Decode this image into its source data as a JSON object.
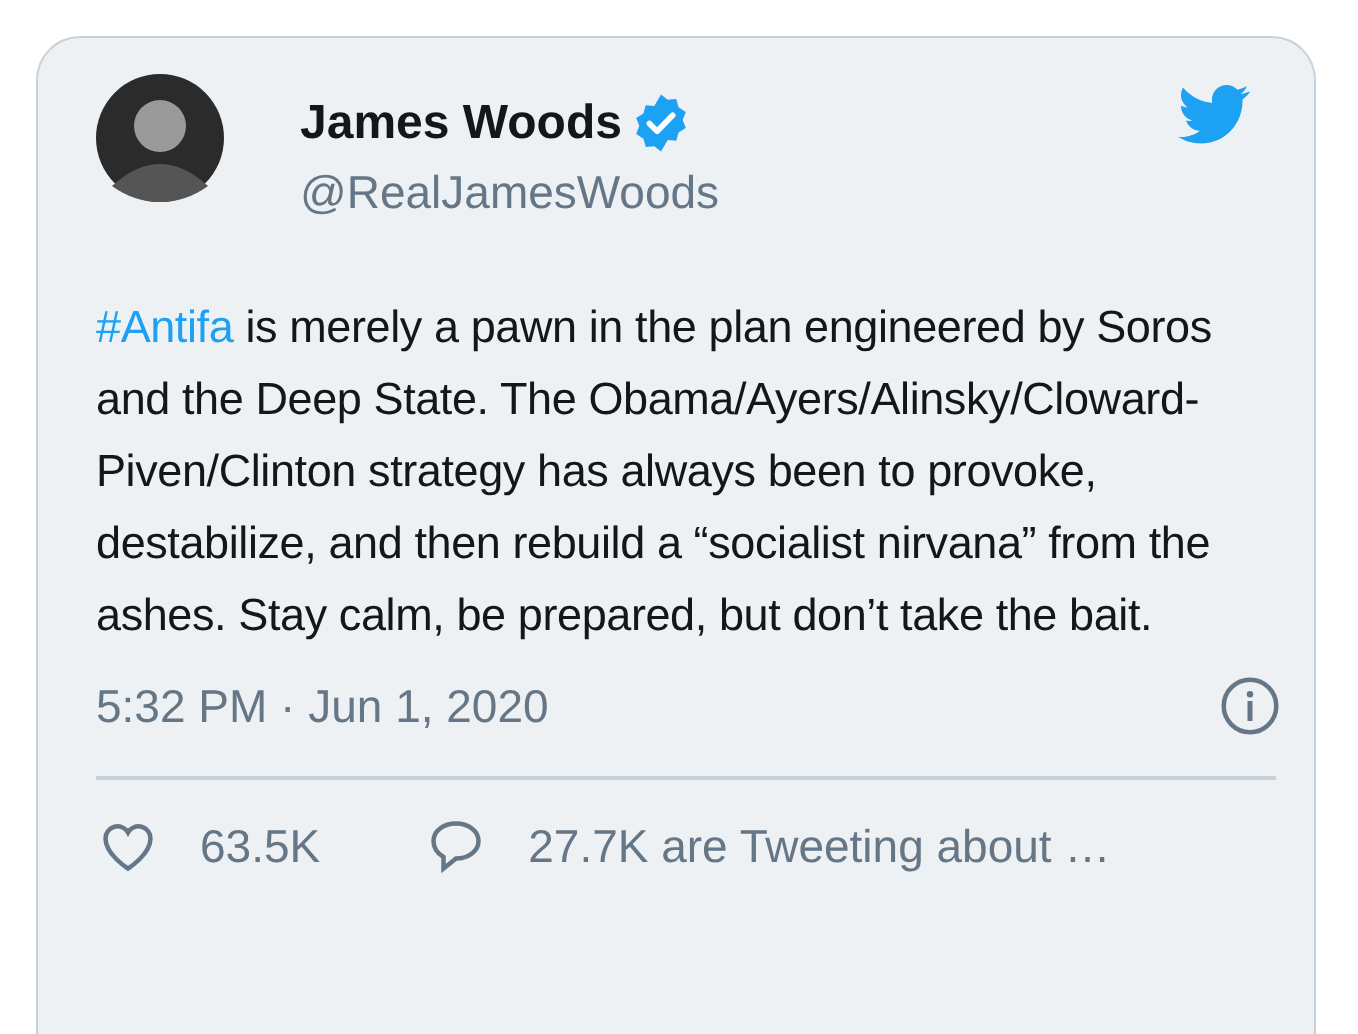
{
  "tweet": {
    "name": "James Woods",
    "verified": true,
    "handle": "@RealJamesWoods",
    "hashtag": "#Antifa",
    "text": " is merely a pawn in the plan engineered by Soros and the Deep State. The Obama/Ayers/Alinsky/Cloward-Piven/Clinton strategy has always been to provoke, destabilize, and then rebuild a “socialist nirvana” from the ashes. Stay calm, be prepared, but don’t take the bait.",
    "timestamp": "5:32 PM · Jun 1, 2020",
    "likes": "63.5K",
    "conversation": "27.7K are Tweeting about …"
  }
}
